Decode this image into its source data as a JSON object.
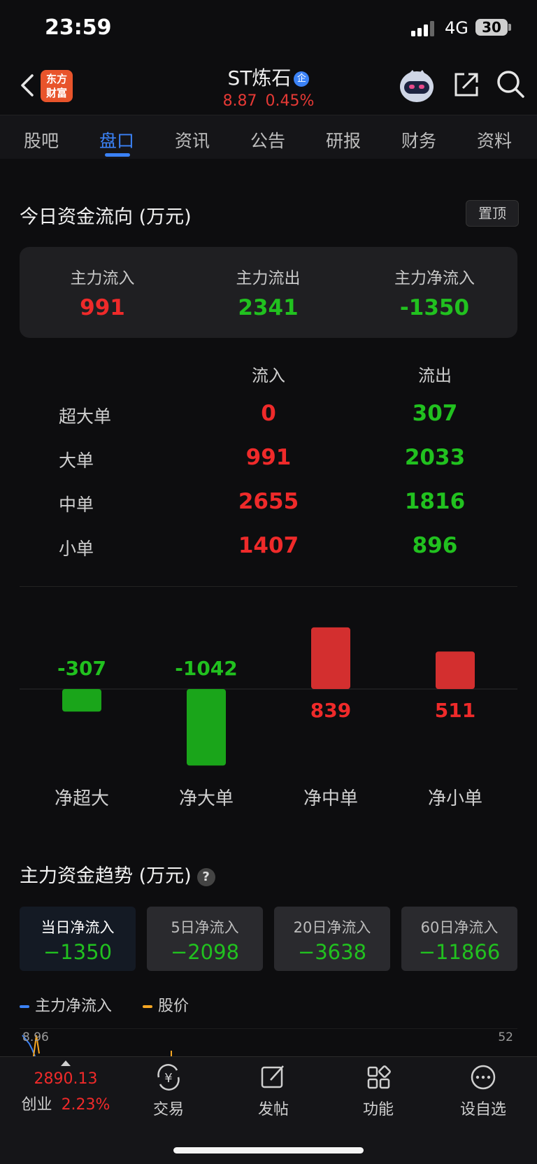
{
  "status": {
    "time": "23:59",
    "network": "4G",
    "battery": "30"
  },
  "header": {
    "logo_line1": "东方",
    "logo_line2": "财富",
    "title": "ST炼石",
    "badge": "企",
    "price": "8.87",
    "change": "0.45%"
  },
  "tabs": [
    {
      "label": "股吧"
    },
    {
      "label": "盘口"
    },
    {
      "label": "资讯"
    },
    {
      "label": "公告"
    },
    {
      "label": "研报"
    },
    {
      "label": "财务"
    },
    {
      "label": "资料"
    }
  ],
  "flow": {
    "title": "今日资金流向 (万元)",
    "pin_label": "置顶",
    "summary": [
      {
        "label": "主力流入",
        "value": "991",
        "color": "#ef2a2a"
      },
      {
        "label": "主力流出",
        "value": "2341",
        "color": "#21c11f"
      },
      {
        "label": "主力净流入",
        "value": "-1350",
        "color": "#21c11f"
      }
    ],
    "col_in": "流入",
    "col_out": "流出",
    "rows": [
      {
        "label": "超大单",
        "in": "0",
        "out": "307"
      },
      {
        "label": "大单",
        "in": "991",
        "out": "2033"
      },
      {
        "label": "中单",
        "in": "2655",
        "out": "1816"
      },
      {
        "label": "小单",
        "in": "1407",
        "out": "896"
      }
    ]
  },
  "chart_data": {
    "type": "bar",
    "categories": [
      "净超大",
      "净大单",
      "净中单",
      "净小单"
    ],
    "values": [
      -307,
      -1042,
      839,
      511
    ],
    "colors": {
      "positive": "#d32f2f",
      "negative": "#1aa51a"
    }
  },
  "trend": {
    "title": "主力资金趋势 (万元)",
    "help": "?",
    "periods": [
      {
        "label": "当日净流入",
        "value": "−1350"
      },
      {
        "label": "5日净流入",
        "value": "−2098"
      },
      {
        "label": "20日净流入",
        "value": "−3638"
      },
      {
        "label": "60日净流入",
        "value": "−11866"
      }
    ],
    "legend": [
      {
        "label": "主力净流入",
        "color": "#3b82f6"
      },
      {
        "label": "股价",
        "color": "#f5a623"
      }
    ],
    "axis_left": "8.96",
    "axis_right": "52"
  },
  "bottom_nav": {
    "index_value": "2890.13",
    "index_name": "创业",
    "index_change": "2.23%",
    "items": [
      {
        "label": "交易",
        "icon": "trade-icon"
      },
      {
        "label": "发帖",
        "icon": "post-icon"
      },
      {
        "label": "功能",
        "icon": "function-icon"
      },
      {
        "label": "设自选",
        "icon": "watchlist-icon"
      }
    ]
  }
}
